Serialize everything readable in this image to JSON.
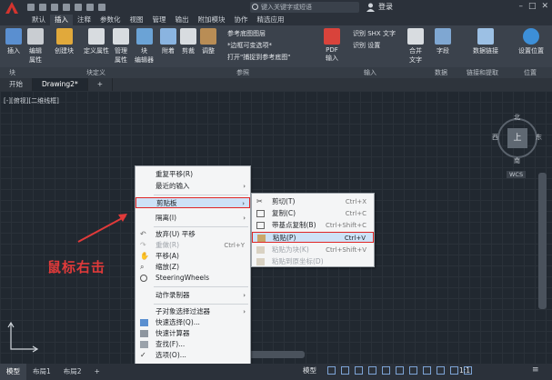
{
  "titlebar": {
    "search_placeholder": "键入关键字或短语",
    "login": "登录"
  },
  "tabs": [
    "默认",
    "插入",
    "注释",
    "参数化",
    "视图",
    "管理",
    "输出",
    "附加模块",
    "协作",
    "精选应用"
  ],
  "active_tab": "插入",
  "ribbon": {
    "tools": {
      "insert": "插入",
      "edit_attr": "编辑\n属性",
      "create_block": "创建块",
      "define_attr": "定义属性",
      "manage_attr": "管理\n属性",
      "block_editor": "块\n编辑器",
      "attach": "附着",
      "clip": "剪裁",
      "adjust": "调整",
      "pdf_import": "PDF\n输入",
      "join": "合并\n文字",
      "field": "字段",
      "data_link": "数据链接",
      "set_location": "设置位置"
    },
    "ref_items": [
      "参考底图图层",
      "*边框可变选项*",
      "打开\"捕捉到参考底图\""
    ],
    "import_items": [
      "识别 SHX 文字",
      "识别 设置"
    ],
    "panels": [
      "块",
      "块定义",
      "参照",
      "输入",
      "数据",
      "链接和提取",
      "位置"
    ]
  },
  "file_tabs": [
    "开始",
    "Drawing2*"
  ],
  "view_label": "[-][俯视][二维线框]",
  "viewcube": {
    "top": "上",
    "north": "北",
    "south": "南",
    "east": "东",
    "west": "西",
    "wcs": "WCS"
  },
  "annotation": "鼠标右击",
  "context_menu": {
    "items": [
      {
        "label": "重复平移(R)"
      },
      {
        "label": "最近的输入",
        "arrow": "›"
      },
      {
        "label": "剪贴板",
        "arrow": "›",
        "highlight": true
      },
      {
        "label": "隔离(I)",
        "arrow": "›"
      },
      {
        "label": "放弃(U) 平移"
      },
      {
        "label": "重做(R)",
        "shortcut": "Ctrl+Y",
        "disabled": true
      },
      {
        "label": "平移(A)"
      },
      {
        "label": "缩放(Z)"
      },
      {
        "label": "SteeringWheels"
      },
      {
        "label": "动作录制器",
        "arrow": "›"
      },
      {
        "label": "子对象选择过滤器",
        "arrow": "›"
      },
      {
        "label": "快速选择(Q)..."
      },
      {
        "label": "快速计算器"
      },
      {
        "label": "查找(F)..."
      },
      {
        "label": "选项(O)..."
      }
    ]
  },
  "clipboard_submenu": {
    "items": [
      {
        "label": "剪切(T)",
        "shortcut": "Ctrl+X"
      },
      {
        "label": "复制(C)",
        "shortcut": "Ctrl+C"
      },
      {
        "label": "带基点复制(B)",
        "shortcut": "Ctrl+Shift+C"
      },
      {
        "label": "粘贴(P)",
        "shortcut": "Ctrl+V",
        "highlight": true
      },
      {
        "label": "粘贴为块(K)",
        "shortcut": "Ctrl+Shift+V",
        "disabled": true
      },
      {
        "label": "粘贴到原坐标(D)",
        "disabled": true
      }
    ]
  },
  "statusbar": {
    "tabs": [
      "模型",
      "布局1",
      "布局2",
      "+"
    ],
    "model": "模型",
    "scale": "1:1"
  },
  "colors": {
    "annotation_red": "#e03a3a",
    "highlight_blue": "#cde2f7"
  }
}
